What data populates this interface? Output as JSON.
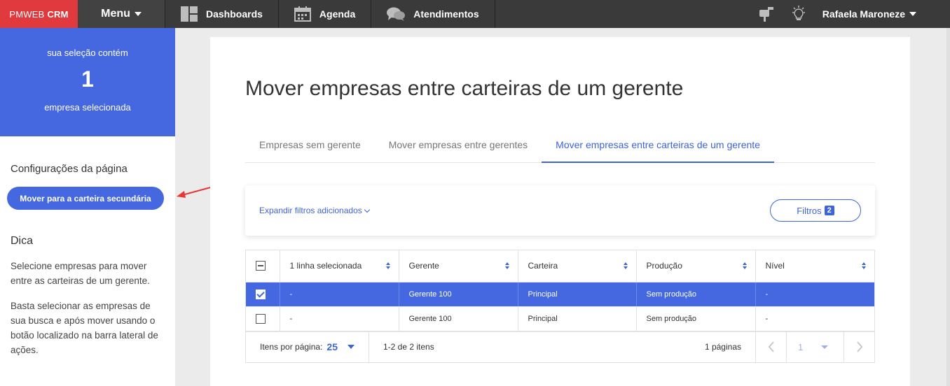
{
  "topbar": {
    "brand_prefix": "PMWEB",
    "brand_suffix": "CRM",
    "menu_label": "Menu",
    "nav": [
      {
        "label": "Dashboards",
        "icon": "dashboard-icon"
      },
      {
        "label": "Agenda",
        "icon": "calendar-icon"
      },
      {
        "label": "Atendimentos",
        "icon": "chat-icon"
      }
    ],
    "user_name": "Rafaela Maroneze",
    "colors": {
      "bar": "#3a3a3a",
      "brand": "#e0393e"
    }
  },
  "sidebar": {
    "selection_top": "sua seleção contém",
    "selection_count": "1",
    "selection_bottom": "empresa selecionada",
    "config_heading": "Configurações da página",
    "move_button": "Mover para a carteira secundária",
    "tip_heading": "Dica",
    "tip_1": "Selecione empresas para mover entre as carteiras de um gerente.",
    "tip_2": "Basta selecionar as empresas de sua busca e após mover usando o botão localizado na barra lateral de ações.",
    "accent": "#4568e0"
  },
  "main": {
    "title": "Mover empresas entre carteiras de um gerente",
    "tabs": [
      {
        "label": "Empresas sem gerente",
        "active": false
      },
      {
        "label": "Mover empresas entre gerentes",
        "active": false
      },
      {
        "label": "Mover empresas entre carteiras de um gerente",
        "active": true
      }
    ],
    "expand_filters": "Expandir filtros adicionados",
    "filters_label": "Filtros",
    "filters_count": "2"
  },
  "table": {
    "columns": [
      "1 linha selecionada",
      "Gerente",
      "Carteira",
      "Produção",
      "Nível"
    ],
    "rows": [
      {
        "selected": true,
        "cells": [
          "-",
          "Gerente 100",
          "Principal",
          "Sem produção",
          "-"
        ]
      },
      {
        "selected": false,
        "cells": [
          "-",
          "Gerente 100",
          "Principal",
          "Sem produção",
          "-"
        ]
      }
    ],
    "per_page_label": "Itens por página:",
    "per_page_value": "25",
    "range_label": "1-2 de 2 itens",
    "pages_label": "1 páginas",
    "current_page": "1"
  }
}
